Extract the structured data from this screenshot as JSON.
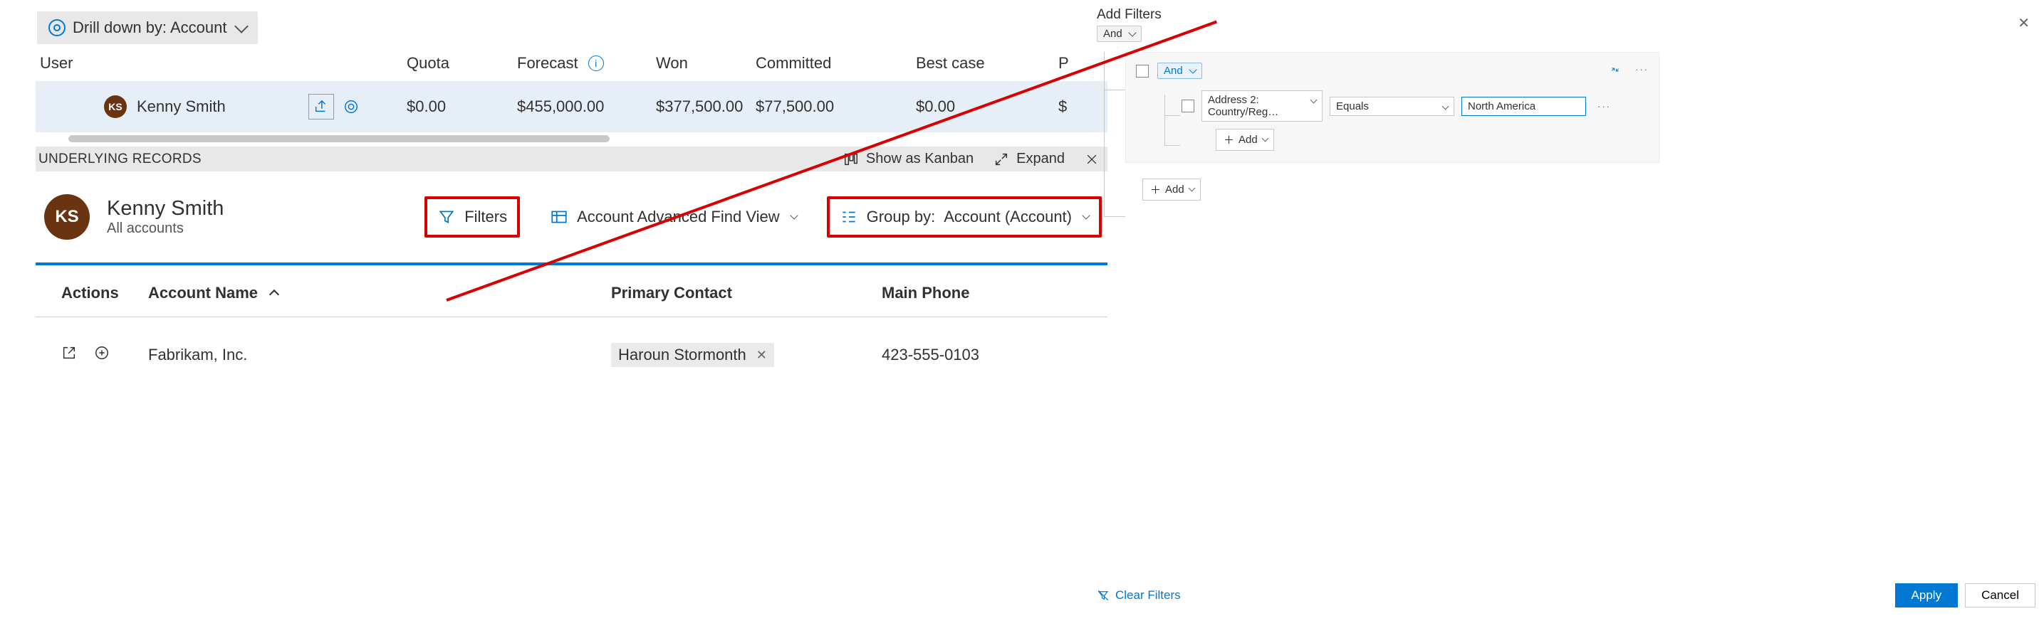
{
  "drilldown": {
    "label": "Drill down by: Account"
  },
  "grid": {
    "headers": {
      "user": "User",
      "quota": "Quota",
      "forecast": "Forecast",
      "won": "Won",
      "committed": "Committed",
      "bestcase": "Best case",
      "extra": "P"
    },
    "row": {
      "avatar_initials": "KS",
      "user": "Kenny Smith",
      "quota": "$0.00",
      "forecast": "$455,000.00",
      "won": "$377,500.00",
      "committed": "$77,500.00",
      "bestcase": "$0.00",
      "extra": "$"
    }
  },
  "underlying": {
    "title": "UNDERLYING RECORDS",
    "show_kanban": "Show as Kanban",
    "expand": "Expand"
  },
  "owner": {
    "avatar_initials": "KS",
    "name": "Kenny Smith",
    "subtitle": "All accounts"
  },
  "toolbar": {
    "filters": "Filters",
    "view": "Account Advanced Find View",
    "groupby_prefix": "Group by:",
    "groupby_value": "Account (Account)"
  },
  "records": {
    "headers": {
      "actions": "Actions",
      "account_name": "Account Name",
      "primary_contact": "Primary Contact",
      "main_phone": "Main Phone"
    },
    "rows": [
      {
        "name": "Fabrikam, Inc.",
        "contact": "Haroun Stormonth",
        "phone": "423-555-0103"
      }
    ]
  },
  "filter_panel": {
    "title": "Add Filters",
    "top_and": "And",
    "group_and": "And",
    "condition": {
      "field": "Address 2: Country/Reg…",
      "operator": "Equals",
      "value": "North America"
    },
    "add_label": "Add",
    "clear": "Clear Filters",
    "apply": "Apply",
    "cancel": "Cancel"
  }
}
